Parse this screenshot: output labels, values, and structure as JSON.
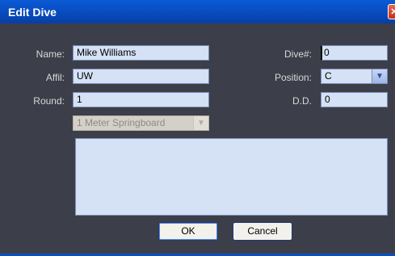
{
  "window": {
    "title": "Edit Dive",
    "close_glyph": "✕"
  },
  "form": {
    "name_label": "Name:",
    "name_value": "Mike Williams",
    "affil_label": "Affil:",
    "affil_value": "UW",
    "round_label": "Round:",
    "round_value": "1",
    "board_value": "1 Meter Springboard",
    "dive_label": "Dive#:",
    "dive_value": "0",
    "position_label": "Position:",
    "position_value": "C",
    "dd_label": "D.D.",
    "dd_value": "0",
    "notes_value": ""
  },
  "buttons": {
    "ok": "OK",
    "cancel": "Cancel"
  },
  "icons": {
    "dropdown": "chevron-down-icon",
    "close": "close-icon"
  }
}
